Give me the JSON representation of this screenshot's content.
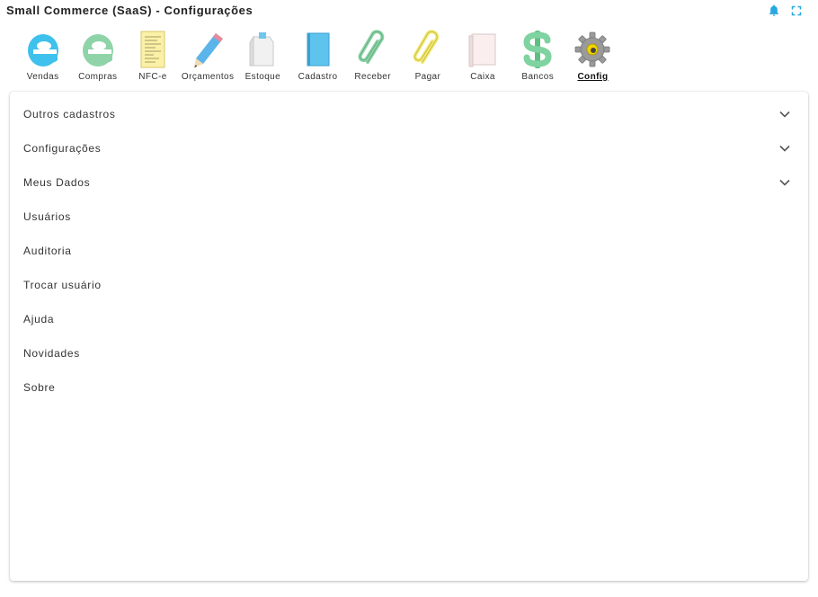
{
  "app": {
    "title": "Small Commerce (SaaS) - Configurações"
  },
  "colors": {
    "accent": "#29a8e0",
    "text": "#333333"
  },
  "top_actions": [
    {
      "icon": "bell-icon"
    },
    {
      "icon": "fullscreen-icon"
    }
  ],
  "toolbar": {
    "items": [
      {
        "label": "Vendas",
        "icon": "vendas-icon"
      },
      {
        "label": "Compras",
        "icon": "compras-icon"
      },
      {
        "label": "NFC-e",
        "icon": "receipt-icon"
      },
      {
        "label": "Orçamentos",
        "icon": "pencil-icon"
      },
      {
        "label": "Estoque",
        "icon": "box-icon"
      },
      {
        "label": "Cadastro",
        "icon": "book-icon"
      },
      {
        "label": "Receber",
        "icon": "paperclip-green-icon"
      },
      {
        "label": "Pagar",
        "icon": "paperclip-yellow-icon"
      },
      {
        "label": "Caixa",
        "icon": "cashbox-icon"
      },
      {
        "label": "Bancos",
        "icon": "dollar-icon"
      },
      {
        "label": "Config",
        "icon": "gear-icon",
        "active": true
      }
    ]
  },
  "menu": {
    "items": [
      {
        "label": "Outros cadastros",
        "expandable": true
      },
      {
        "label": "Configurações",
        "expandable": true
      },
      {
        "label": "Meus Dados",
        "expandable": true
      },
      {
        "label": "Usuários",
        "expandable": false
      },
      {
        "label": "Auditoria",
        "expandable": false
      },
      {
        "label": "Trocar usuário",
        "expandable": false
      },
      {
        "label": "Ajuda",
        "expandable": false
      },
      {
        "label": "Novidades",
        "expandable": false
      },
      {
        "label": "Sobre",
        "expandable": false
      }
    ]
  }
}
